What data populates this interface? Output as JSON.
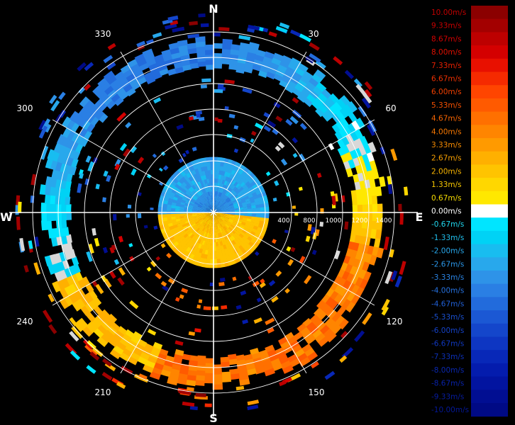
{
  "compass": {
    "north": "N",
    "south": "S",
    "east": "E",
    "west": "W"
  },
  "bearings": [
    "30",
    "60",
    "120",
    "150",
    "210",
    "240",
    "300",
    "330"
  ],
  "range_labels": [
    "400",
    "800",
    "1000",
    "1200",
    "1400"
  ],
  "legend": {
    "labels": [
      "10.00m/s",
      "9.33m/s",
      "8.67m/s",
      "8.00m/s",
      "7.33m/s",
      "6.67m/s",
      "6.00m/s",
      "5.33m/s",
      "4.67m/s",
      "4.00m/s",
      "3.33m/s",
      "2.67m/s",
      "2.00m/s",
      "1.33m/s",
      "0.67m/s",
      "0.00m/s",
      "-0.67m/s",
      "-1.33m/s",
      "-2.00m/s",
      "-2.67m/s",
      "-3.33m/s",
      "-4.00m/s",
      "-4.67m/s",
      "-5.33m/s",
      "-6.00m/s",
      "-6.67m/s",
      "-7.33m/s",
      "-8.00m/s",
      "-8.67m/s",
      "-9.33m/s",
      "-10.00m/s"
    ],
    "colors": [
      "#8b0000",
      "#a30000",
      "#bd0000",
      "#d40000",
      "#e81000",
      "#f52a00",
      "#ff4500",
      "#ff5a00",
      "#ff7000",
      "#ff8500",
      "#ff9a00",
      "#ffb000",
      "#ffc400",
      "#ffd700",
      "#ffe800",
      "#ffffff",
      "#00e5ff",
      "#00d2f5",
      "#18bdf0",
      "#28a8ec",
      "#2e93e8",
      "#2a7fe4",
      "#226bdc",
      "#1b58d4",
      "#1446cb",
      "#0e36c2",
      "#0828b8",
      "#041cad",
      "#0214a0",
      "#010e92",
      "#000a85"
    ],
    "label_colors": [
      "#c00000",
      "#c80000",
      "#d40000",
      "#e01000",
      "#e82000",
      "#ee3000",
      "#f24000",
      "#f55000",
      "#f76400",
      "#f87800",
      "#f88c00",
      "#f8a000",
      "#f8b400",
      "#f8c800",
      "#f8dc00",
      "#ffffff",
      "#20d8f0",
      "#20c0ee",
      "#28a8ec",
      "#2a96e8",
      "#2a84e4",
      "#2672e0",
      "#2060d8",
      "#1a50d0",
      "#1442c8",
      "#1038c0",
      "#0c30b8",
      "#0a28b0",
      "#0822a8",
      "#061ca0",
      "#041898"
    ]
  }
}
